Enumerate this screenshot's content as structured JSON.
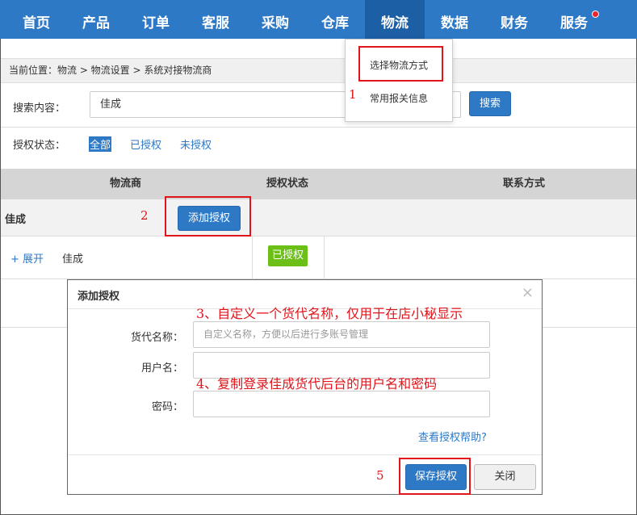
{
  "nav": {
    "items": [
      "首页",
      "产品",
      "订单",
      "客服",
      "采购",
      "仓库",
      "物流",
      "数据",
      "财务",
      "服务"
    ],
    "active_index": 6
  },
  "dropdown": {
    "items": [
      "选择物流方式",
      "常用报关信息"
    ]
  },
  "breadcrumb": "当前位置：物流 > 物流设置 > 系统对接物流商",
  "search": {
    "label": "搜索内容：",
    "value": "佳成",
    "button": "搜索"
  },
  "filter": {
    "label": "授权状态：",
    "options": [
      "全部",
      "已授权",
      "未授权"
    ],
    "selected_index": 0
  },
  "table": {
    "headers": [
      "物流商",
      "授权状态",
      "联系方式"
    ],
    "provider_name": "佳成",
    "add_auth_button": "添加授权",
    "expand_link": "+ 展开",
    "sub_provider_name": "佳成",
    "status_badge": "已授权"
  },
  "modal": {
    "title": "添加授权",
    "close": "×",
    "fields": [
      {
        "label": "货代名称：",
        "placeholder": "自定义名称，方便以后进行多账号管理"
      },
      {
        "label": "用户名：",
        "placeholder": ""
      },
      {
        "label": "密码：",
        "placeholder": ""
      }
    ],
    "help_link": "查看授权帮助?",
    "save_button": "保存授权",
    "close_button": "关闭"
  },
  "annotations": {
    "num1": "1",
    "num2": "2",
    "num5": "5",
    "note3": "3、自定义一个货代名称，仅用于在店小秘显示",
    "note4": "4、复制登录佳成货代后台的用户名和密码"
  },
  "colors": {
    "nav_bg": "#2e79c6",
    "nav_active": "#1d5fa5",
    "primary": "#2e79c6",
    "badge_green": "#6bbf17",
    "annotation_red": "#e0151b"
  }
}
